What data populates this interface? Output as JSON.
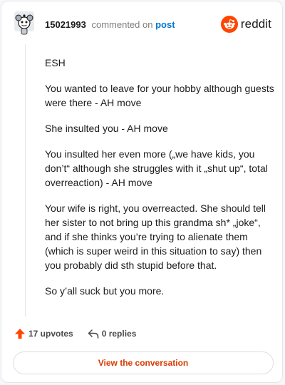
{
  "header": {
    "username": "15021993",
    "commented_text": "commented on",
    "post_link": "post",
    "brand": "reddit",
    "brand_color": "#ff4500"
  },
  "comment": {
    "paragraphs": [
      "ESH",
      "You wanted to leave for your hobby although guests were there - AH move",
      "She insulted you - AH move",
      "You insulted her even more („we have kids, you don’t“ although she struggles with it „shut up“, total overreaction) - AH move",
      "Your wife is right, you overreacted. She should tell her sister to not bring up this grandma sh* „joke“, and if she thinks you’re trying to alienate them (which is super weird in this situation to say) then you probably did sth stupid before that.",
      "So y’all suck but you more."
    ]
  },
  "actions": {
    "upvotes": "17 upvotes",
    "replies": "0 replies",
    "upvote_icon": "upvote-arrow-icon",
    "reply_icon": "reply-icon"
  },
  "cta": {
    "label": "View the conversation"
  }
}
